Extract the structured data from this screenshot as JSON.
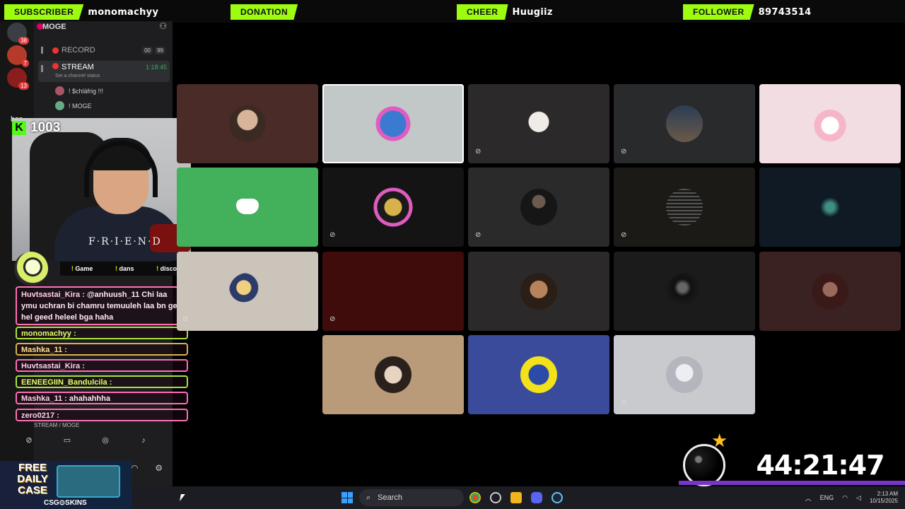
{
  "alerts": [
    {
      "label": "SUBSCRIBER",
      "value": "monomachyy"
    },
    {
      "label": "DONATION",
      "value": ""
    },
    {
      "label": "CHEER",
      "value": "Huugiiz"
    },
    {
      "label": "FOLLOWER",
      "value": "89743514"
    }
  ],
  "server_strip": {
    "badges": [
      "38",
      "7",
      "13"
    ],
    "text_label": "bss"
  },
  "channels": {
    "server_name": "MOGE",
    "record": {
      "name": "RECORD",
      "chip_a": "00",
      "chip_b": "99"
    },
    "stream": {
      "name": "STREAM",
      "time": "1:18:45",
      "status": "Set a channel status"
    },
    "members": [
      "! $chläfrig !!!",
      "! MOGE"
    ],
    "voice_status": "STREAM / MOGE"
  },
  "kick": {
    "viewers": "1003"
  },
  "webcam": {
    "shirt_text": "F·R·I·E·N·D"
  },
  "commands": [
    "Game",
    "dans",
    "discord"
  ],
  "chat": [
    {
      "name": "Huvtsastai_Kira :",
      "msg": "@anhuush_11 Chi laa ymu uchran bi chamru temuuleh laa bn gej hel geed heleel bga haha",
      "style": "pink"
    },
    {
      "name": "monomachyy :",
      "msg": "",
      "style": "green"
    },
    {
      "name": "Mashka_11 :",
      "msg": "",
      "style": "gold"
    },
    {
      "name": "Huvtsastai_Kira :",
      "msg": "",
      "style": "pink"
    },
    {
      "name": "EENEEGIIN_Bandulcila :",
      "msg": "",
      "style": "green"
    },
    {
      "name": "Mashka_11 :",
      "msg": "ahahahhha",
      "style": "pink"
    },
    {
      "name": "zero0217 :",
      "msg": "",
      "style": "pink"
    }
  ],
  "timer": {
    "value": "44:21:47"
  },
  "ad": {
    "title": "FREE DAILY CASE",
    "brand": "CSG⊙SKINS"
  },
  "taskbar": {
    "search_placeholder": "Search",
    "language": "ENG",
    "time": "2:13 AM",
    "date": "10/15/2025"
  },
  "colors": {
    "alert_tag": "#9dfc0f",
    "kick_green": "#53fc18",
    "discord_green": "#43b05c",
    "timer_bar": "#7a35c8"
  },
  "icons": {
    "discord_logo_tile": "discord-icon",
    "muted_user": "mic-off-icon"
  }
}
